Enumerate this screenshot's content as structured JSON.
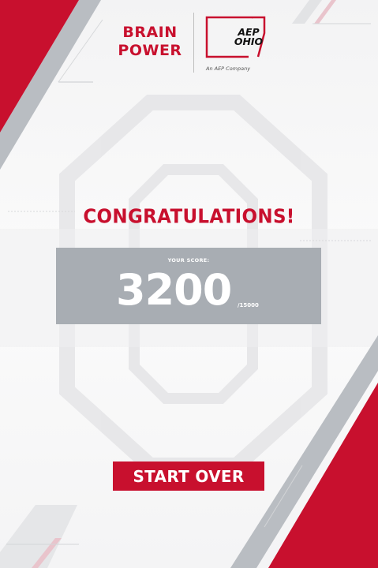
{
  "header": {
    "brand_line1": "BRAIN",
    "brand_line2": "POWER",
    "partner_line1": "AEP",
    "partner_line2": "OHIO",
    "partner_tagline": "An AEP Company"
  },
  "results": {
    "heading": "CONGRATULATIONS!",
    "score_label": "YOUR SCORE:",
    "score": "3200",
    "score_max": "/15000"
  },
  "actions": {
    "start_over_label": "START OVER"
  },
  "colors": {
    "brand_red": "#c8102e",
    "panel_gray": "#a8adb3",
    "deco_gray": "#c3c7cc"
  },
  "icons": {
    "background_watermark": "block-o-watermark-icon",
    "partner_logo": "aep-ohio-logo"
  }
}
